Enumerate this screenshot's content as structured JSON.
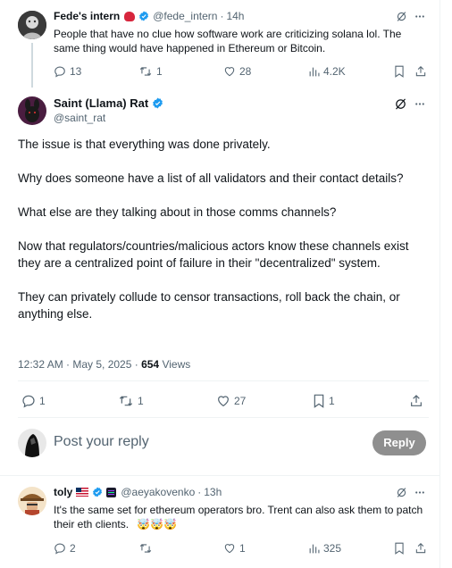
{
  "tweet1": {
    "name": "Fede's intern",
    "handle": "@fede_intern",
    "dot": "·",
    "time": "14h",
    "text": "People that have no clue how software work are criticizing solana lol. The same thing would have happened in Ethereum or Bitcoin.",
    "replies": "13",
    "reposts": "1",
    "likes": "28",
    "views": "4.2K"
  },
  "main": {
    "name": "Saint (Llama) Rat",
    "handle": "@saint_rat",
    "paragraphs": [
      "The issue is that everything was done privately.",
      "Why does someone have a list of all validators and their contact details?",
      "What else are they talking about in those comms channels?",
      "Now that regulators/countries/malicious actors know these channels exist they are a centralized point of failure in their \"decentralized\" system.",
      "They can privately collude to censor transactions, roll back the chain, or anything else."
    ],
    "timestamp": "12:32 AM · May 5, 2025 · ",
    "views_count": "654",
    "views_label": " Views",
    "replies": "1",
    "reposts": "1",
    "likes": "27",
    "bookmarks": "1"
  },
  "reply_box": {
    "placeholder": "Post your reply",
    "button": "Reply"
  },
  "tweet3": {
    "name": "toly",
    "handle": "@aeyakovenko",
    "dot": "·",
    "time": "13h",
    "text": "It's the same set for ethereum operators bro.  Trent can also ask them to patch their eth clients.",
    "emojis": "🤯🤯🤯",
    "replies": "2",
    "reposts": "",
    "likes": "1",
    "views": "325"
  },
  "colors": {
    "accent": "#1d9bf0",
    "muted": "#536471",
    "reply_button": "#8f8f8f"
  },
  "icons": [
    "grok-icon",
    "more-icon",
    "reply-icon",
    "repost-icon",
    "like-icon",
    "views-icon",
    "bookmark-icon",
    "share-icon",
    "verified-icon"
  ]
}
